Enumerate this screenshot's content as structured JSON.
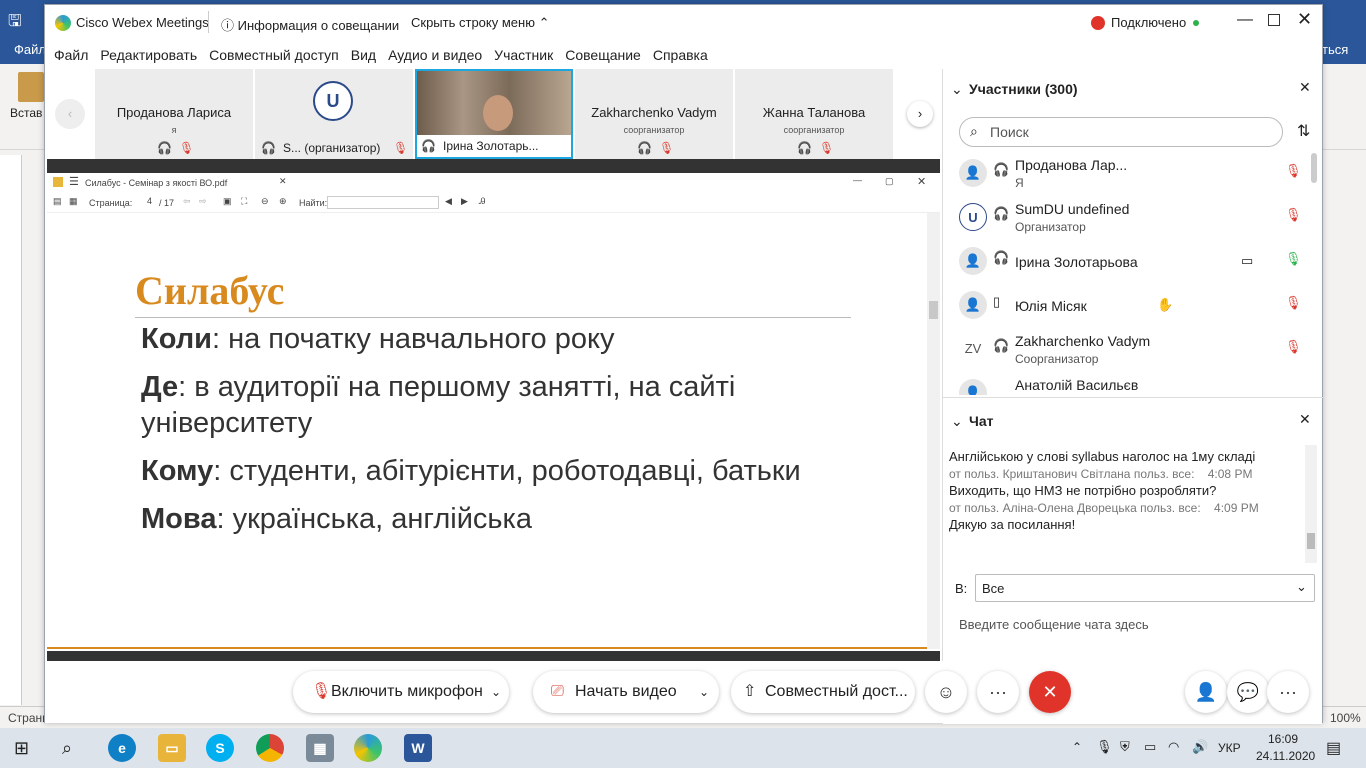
{
  "background_app": {
    "menu_file": "Файл",
    "menu_right": "ться",
    "paste_label": "Встав",
    "status_left": "Страни",
    "zoom": "100%"
  },
  "window": {
    "app_title": "Cisco Webex Meetings",
    "meeting_info": "Информация о совещании",
    "hide_bar": "Скрыть строку меню",
    "connection_status": "Подключено"
  },
  "menu": [
    "Файл",
    "Редактировать",
    "Совместный доступ",
    "Вид",
    "Аудио и видео",
    "Участник",
    "Совещание",
    "Справка"
  ],
  "thumbnails": [
    {
      "name": "Проданова Лариса",
      "role": "я",
      "bar": ""
    },
    {
      "name": "",
      "role": "",
      "bar": "S... (организатор)"
    },
    {
      "name": "",
      "role": "",
      "bar": "Ірина Золотарь..."
    },
    {
      "name": "Zakharchenko Vadym",
      "role": "соорганизатор",
      "bar": ""
    },
    {
      "name": "Жанна Таланова",
      "role": "соорганизатор",
      "bar": ""
    }
  ],
  "pdf": {
    "title": "Силабус - Семінар з якості ВО.pdf",
    "page_label": "Страница:",
    "page_current": "4",
    "page_total": "/ 17",
    "find_label": "Найти:"
  },
  "slide": {
    "title": "Силабус",
    "lines": [
      {
        "key": "Коли",
        "text": ": на початку навчального року"
      },
      {
        "key": "Де",
        "text": ": в аудиторії на першому занятті, на сайті університету"
      },
      {
        "key": "Кому",
        "text": ": студенти, абітурієнти, роботодавці, батьки"
      },
      {
        "key": "Мова",
        "text": ": українська, англійська"
      }
    ]
  },
  "participants": {
    "header": "Участники (300)",
    "search_placeholder": "Поиск",
    "list": [
      {
        "name": "Проданова Лар...",
        "role": "Я",
        "avatar": ""
      },
      {
        "name": "SumDU undefined",
        "role": "Организатор",
        "avatar": ""
      },
      {
        "name": "Ірина Золотарьова",
        "role": "",
        "avatar": ""
      },
      {
        "name": "Юлія Місяк",
        "role": "",
        "avatar": ""
      },
      {
        "name": "Zakharchenko Vadym",
        "role": "Соорганизатор",
        "avatar": "ZV"
      },
      {
        "name": "Анатолій Васильєв",
        "role": "",
        "avatar": ""
      }
    ]
  },
  "chat": {
    "header": "Чат",
    "messages": [
      {
        "text": "Англійською у слові syllabus наголос на 1му складі",
        "meta": "от польз. Криштанович Світлана польз. все:",
        "time": "4:08 PM"
      },
      {
        "text": "Виходить, що НМЗ не потрібно розробляти?",
        "meta": "от польз. Аліна-Олена Дворецька польз. все:",
        "time": "4:09 PM"
      },
      {
        "text": "Дякую за посилання!",
        "meta": "",
        "time": ""
      }
    ],
    "to_label": "В:",
    "to_value": "Все",
    "input_placeholder": "Введите сообщение чата здесь"
  },
  "controls": {
    "mic": "Включить микрофон",
    "video": "Начать видео",
    "share": "Совместный дост..."
  },
  "taskbar": {
    "lang": "УКР",
    "time": "16:09",
    "date": "24.11.2020"
  }
}
